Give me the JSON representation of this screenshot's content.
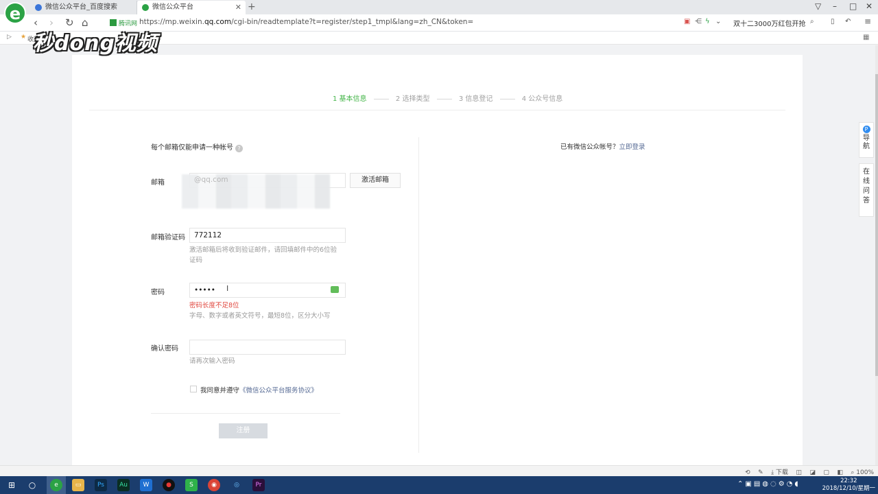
{
  "browser": {
    "tabs": [
      {
        "label": "微信公众平台_百度搜索",
        "favicon_color": "#3a75d9",
        "active": false
      },
      {
        "label": "微信公众平台",
        "favicon_color": "#2ba245",
        "active": true
      }
    ],
    "new_tab": "+",
    "address": {
      "security_label": "腾讯网",
      "url_prefix": "https://mp.weixin.",
      "url_host": "qq.com",
      "url_rest": "/cgi-bin/readtemplate?t=register/step1_tmpl&lang=zh_CN&token="
    },
    "promo_text": "双十二3000万红包开抢",
    "bookmarks_text": "收藏"
  },
  "watermark": "秒dong视频",
  "register": {
    "steps": [
      {
        "label": "1 基本信息",
        "active": true
      },
      {
        "label": "2 选择类型",
        "active": false
      },
      {
        "label": "3 信息登记",
        "active": false
      },
      {
        "label": "4 公众号信息",
        "active": false
      }
    ],
    "notice": "每个邮箱仅能申请一种帐号",
    "notice_help": "?",
    "email": {
      "label": "邮箱",
      "value": "@qq.com",
      "activate_button": "激活邮箱"
    },
    "code": {
      "label": "邮箱验证码",
      "value": "772112",
      "hint": "激活邮箱后将收到验证邮件，请回填邮件中的6位验证码"
    },
    "password": {
      "label": "密码",
      "value": "•••••",
      "error": "密码长度不足8位",
      "hint": "字母、数字或者英文符号，最短8位，区分大小写"
    },
    "confirm": {
      "label": "确认密码",
      "value": "",
      "hint": "请再次输入密码"
    },
    "agreement": {
      "prefix": "我同意并遵守",
      "link": "《微信公众平台服务协议》",
      "checked": false
    },
    "submit": "注册",
    "login_prompt": "已有微信公众帐号？",
    "login_link": "立即登录"
  },
  "float_widgets": {
    "nav": "导航",
    "nav_badge": "P",
    "qa": "在线问答"
  },
  "statusbar": {
    "download": "下载",
    "zoom": "100%"
  },
  "taskbar": {
    "time": "22:32",
    "date": "2018/12/10/星期一"
  }
}
